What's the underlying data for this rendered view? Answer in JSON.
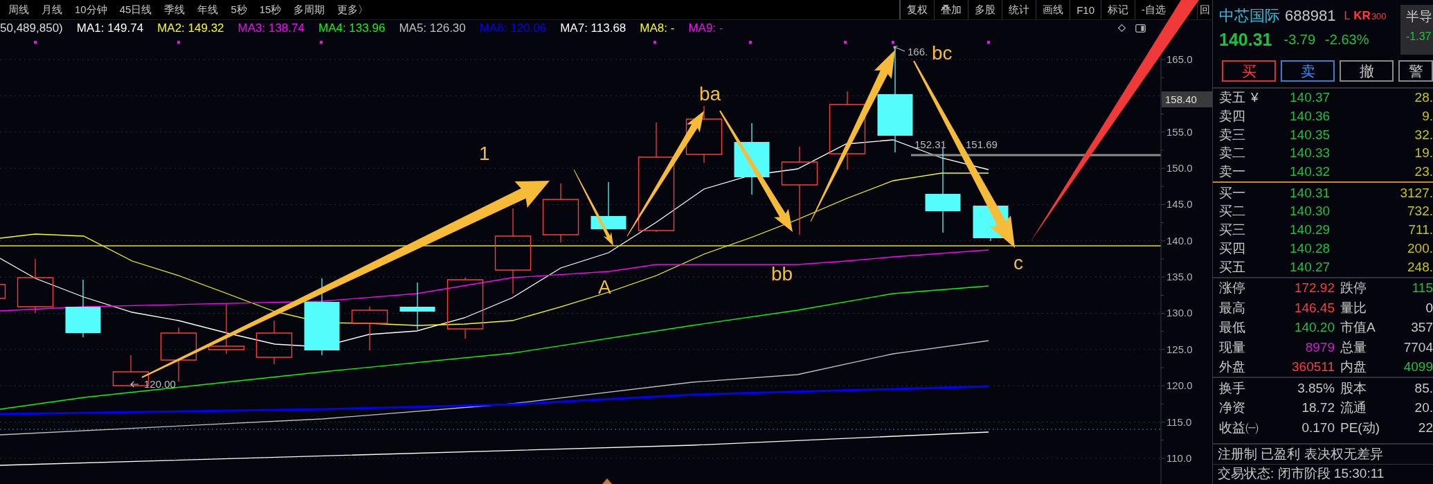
{
  "period_toolbar": {
    "items": [
      "周线",
      "月线",
      "10分钟",
      "45日线",
      "季线",
      "年线",
      "5秒",
      "15秒",
      "多周期",
      "更多〉"
    ]
  },
  "tool_toolbar": {
    "items": [
      "复权",
      "叠加",
      "多股",
      "统计",
      "画线",
      "F10",
      "标记",
      "-自选",
      "回"
    ]
  },
  "indicator_legend": {
    "lead": "50,489,850)",
    "items": [
      {
        "label": "MA1: 149.74",
        "color": "#ffffff"
      },
      {
        "label": "MA2: 149.32",
        "color": "#ffff00"
      },
      {
        "label": "MA3: 138.74",
        "color": "#ff00ff"
      },
      {
        "label": "MA4: 133.96",
        "color": "#00ff00"
      },
      {
        "label": "MA5: 126.30",
        "color": "#c0c0c0"
      },
      {
        "label": "MA6: 120.06",
        "color": "#0000ff"
      },
      {
        "label": "MA7: 113.68",
        "color": "#ffffff"
      },
      {
        "label": "MA8: -",
        "color": "#ffff00"
      },
      {
        "label": "MA9: -",
        "color": "#ff00ff"
      }
    ]
  },
  "chart": {
    "price_axis": [
      "165.0",
      "155.0",
      "150.0",
      "145.0",
      "140.0",
      "135.0",
      "130.0",
      "125.0",
      "120.0",
      "115.0",
      "110.0"
    ],
    "price_tag": "158.40",
    "price_notes": [
      "120.00",
      "166.",
      "152.31",
      "151.69"
    ],
    "wave_labels": [
      "1",
      "A",
      "ba",
      "bb",
      "bc",
      "c"
    ]
  },
  "quote": {
    "name": "中芯国际",
    "code": "688981",
    "flags": [
      {
        "text": "L",
        "kind": "plain"
      },
      {
        "text": "KR",
        "kind": "bold"
      },
      {
        "text": "300",
        "kind": "small"
      }
    ],
    "price": "140.31",
    "change": "-3.79",
    "change_pct": "-2.63%",
    "falling": true,
    "sector": {
      "name": "半导",
      "change": "-1.37",
      "falling": true
    },
    "trade_buttons": [
      {
        "label": "买",
        "kind": "buy"
      },
      {
        "label": "卖",
        "kind": "sell"
      },
      {
        "label": "撤",
        "kind": "cancel"
      },
      {
        "label": "警",
        "kind": "alert"
      }
    ],
    "asks": [
      {
        "label": "卖五",
        "symbol": "¥",
        "price": "140.37",
        "volume": "28."
      },
      {
        "label": "卖四",
        "price": "140.36",
        "volume": "9."
      },
      {
        "label": "卖三",
        "price": "140.35",
        "volume": "32."
      },
      {
        "label": "卖二",
        "price": "140.33",
        "volume": "19."
      },
      {
        "label": "卖一",
        "price": "140.32",
        "volume": "23."
      }
    ],
    "bids": [
      {
        "label": "买一",
        "price": "140.31",
        "volume": "3127."
      },
      {
        "label": "买二",
        "price": "140.30",
        "volume": "732."
      },
      {
        "label": "买三",
        "price": "140.29",
        "volume": "711."
      },
      {
        "label": "买四",
        "price": "140.28",
        "volume": "200."
      },
      {
        "label": "买五",
        "price": "140.27",
        "volume": "248."
      }
    ],
    "stats": [
      {
        "label": "涨停",
        "value": "172.92",
        "color": "#ff3b3b"
      },
      {
        "label": "跌停",
        "value": "115",
        "color": "#19c43c"
      },
      {
        "label": "最高",
        "value": "146.45",
        "color": "#ff3b3b"
      },
      {
        "label": "量比",
        "value": "0",
        "color": "#dcdcdc"
      },
      {
        "label": "最低",
        "value": "140.20",
        "color": "#19c43c"
      },
      {
        "label": "市值A",
        "value": "357",
        "color": "#c8c8c8"
      },
      {
        "label": "现量",
        "value": "8979",
        "color": "#d21ed2"
      },
      {
        "label": "总量",
        "value": "7704",
        "color": "#c8c8c8"
      },
      {
        "label": "外盘",
        "value": "360511",
        "color": "#ff3b3b"
      },
      {
        "label": "内盘",
        "value": "4099",
        "color": "#19c43c"
      }
    ],
    "fundamentals": [
      {
        "label": "换手",
        "value": "3.85%"
      },
      {
        "label": "股本",
        "value": "85."
      },
      {
        "label": "净资",
        "value": "18.72"
      },
      {
        "label": "流通",
        "value": "20."
      },
      {
        "label": "收益㈠",
        "value": "0.170"
      },
      {
        "label": "PE(动)",
        "value": "22"
      }
    ],
    "tags": "注册制 已盈利 表决权无差异",
    "status": "交易状态: 闭市阶段 15:30:11"
  }
}
